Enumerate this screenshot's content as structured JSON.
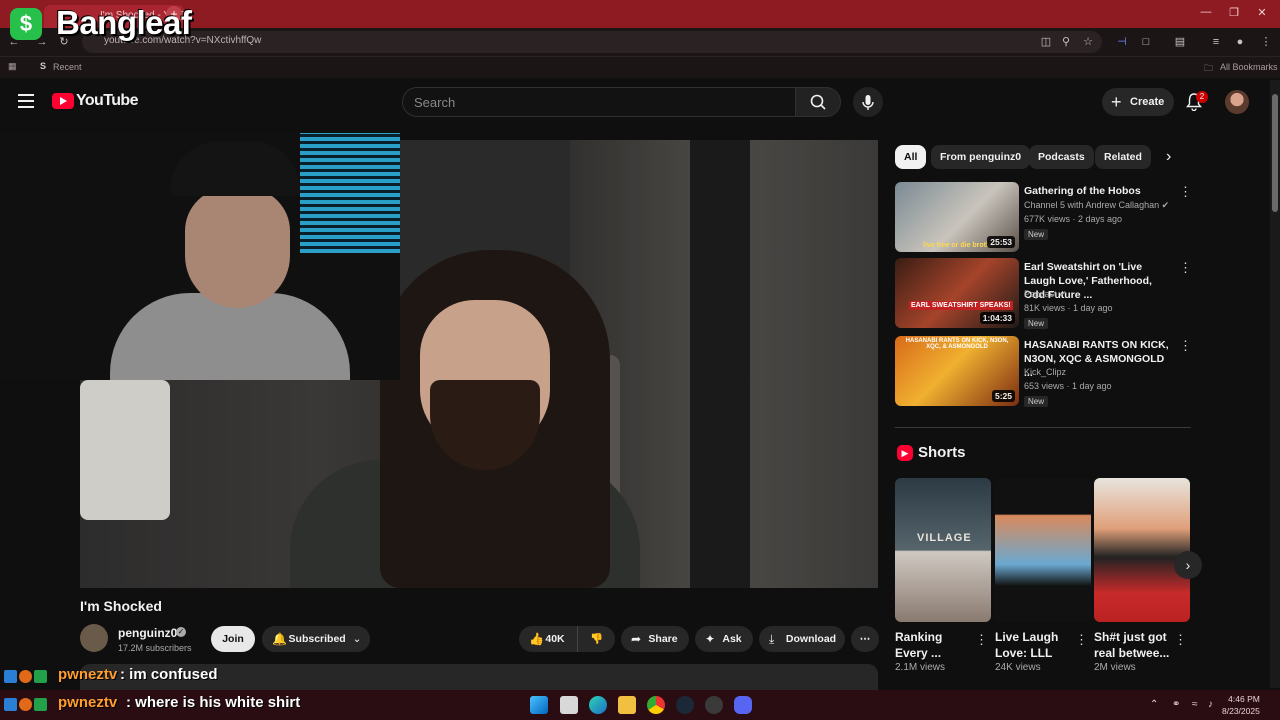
{
  "overlay": {
    "logo_symbol": "$",
    "brand": "Bangleaf"
  },
  "browser": {
    "tab_title": "I'm Shocked - YouTube",
    "url": "youtube.com/watch?v=NXctivhffQw",
    "bookmarks_recent": "Recent",
    "all_bookmarks": "All Bookmarks"
  },
  "youtube": {
    "wordmark": "YouTube",
    "search_placeholder": "Search",
    "create_label": "Create",
    "notification_count": "2"
  },
  "video": {
    "title": "I'm Shocked",
    "channel": "penguinz0",
    "subscribers": "17.2M subscribers",
    "join": "Join",
    "subscribed": "Subscribed",
    "likes": "40K",
    "share": "Share",
    "ask": "Ask",
    "download": "Download"
  },
  "sidebar": {
    "chips": [
      "All",
      "From penguinz0",
      "Podcasts",
      "Related"
    ],
    "recommendations": [
      {
        "title": "Gathering of the Hobos",
        "channel": "Channel 5 with Andrew Callaghan",
        "meta": "677K views · 2 days ago",
        "badge": "New",
        "duration": "25:53",
        "thumb_caption": "live free or die brother",
        "verified": true
      },
      {
        "title": "Earl Sweatshirt on 'Live Laugh Love,' Fatherhood, Odd Future ...",
        "channel": "Popcast",
        "meta": "81K views · 1 day ago",
        "badge": "New",
        "duration": "1:04:33",
        "thumb_caption": "EARL SWEATSHIRT SPEAKS!",
        "verified": true
      },
      {
        "title": "HASANABI RANTS ON KICK, N3ON, XQC & ASMONGOLD ...",
        "channel": "Kick_Clipz",
        "meta": "653 views · 1 day ago",
        "badge": "New",
        "duration": "5:25",
        "thumb_caption": "HASANABI RANTS ON KICK, N3ON, XQC, & ASMONGOLD",
        "verified": false
      }
    ],
    "shorts_heading": "Shorts",
    "shorts": [
      {
        "title": "Ranking Every ...",
        "views": "2.1M views",
        "thumb_caption": "VILLAGE"
      },
      {
        "title": "Live Laugh Love: LLL",
        "views": "24K views",
        "thumb_caption": ""
      },
      {
        "title": "Sh#t just got real betwee...",
        "views": "2M views",
        "thumb_caption": ""
      }
    ]
  },
  "chat": [
    {
      "user": "pwneztv",
      "message": ": im confused"
    },
    {
      "user": "pwneztv",
      "message": ": where is his white shirt"
    }
  ],
  "taskbar": {
    "time": "4:46 PM",
    "date": "8/23/2025"
  },
  "colors": {
    "browser_frame": "#8e1a22",
    "youtube_red": "#ff0033",
    "chat_name": "#ff9d2e",
    "overlay_green": "#26c04b"
  }
}
